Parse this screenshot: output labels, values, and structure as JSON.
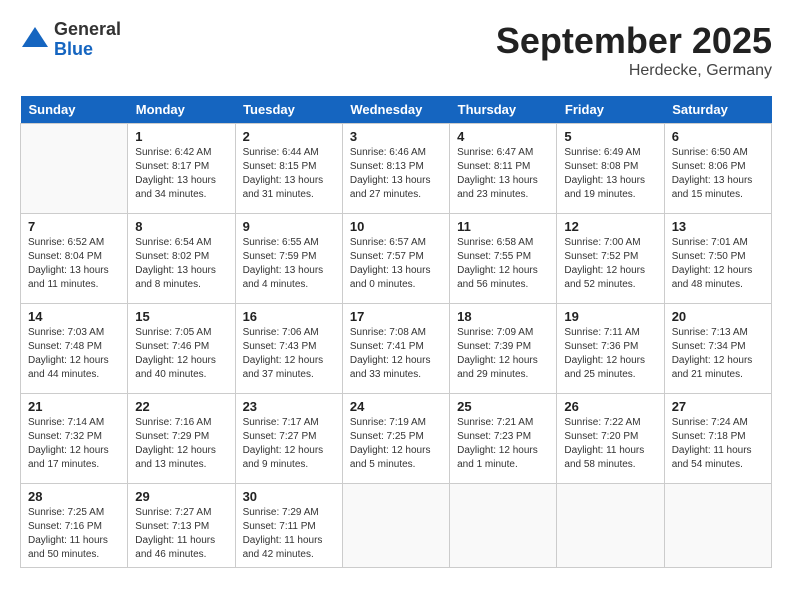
{
  "header": {
    "logo_general": "General",
    "logo_blue": "Blue",
    "month_title": "September 2025",
    "location": "Herdecke, Germany"
  },
  "days_of_week": [
    "Sunday",
    "Monday",
    "Tuesday",
    "Wednesday",
    "Thursday",
    "Friday",
    "Saturday"
  ],
  "weeks": [
    [
      {
        "day": "",
        "info": ""
      },
      {
        "day": "1",
        "info": "Sunrise: 6:42 AM\nSunset: 8:17 PM\nDaylight: 13 hours and 34 minutes."
      },
      {
        "day": "2",
        "info": "Sunrise: 6:44 AM\nSunset: 8:15 PM\nDaylight: 13 hours and 31 minutes."
      },
      {
        "day": "3",
        "info": "Sunrise: 6:46 AM\nSunset: 8:13 PM\nDaylight: 13 hours and 27 minutes."
      },
      {
        "day": "4",
        "info": "Sunrise: 6:47 AM\nSunset: 8:11 PM\nDaylight: 13 hours and 23 minutes."
      },
      {
        "day": "5",
        "info": "Sunrise: 6:49 AM\nSunset: 8:08 PM\nDaylight: 13 hours and 19 minutes."
      },
      {
        "day": "6",
        "info": "Sunrise: 6:50 AM\nSunset: 8:06 PM\nDaylight: 13 hours and 15 minutes."
      }
    ],
    [
      {
        "day": "7",
        "info": "Sunrise: 6:52 AM\nSunset: 8:04 PM\nDaylight: 13 hours and 11 minutes."
      },
      {
        "day": "8",
        "info": "Sunrise: 6:54 AM\nSunset: 8:02 PM\nDaylight: 13 hours and 8 minutes."
      },
      {
        "day": "9",
        "info": "Sunrise: 6:55 AM\nSunset: 7:59 PM\nDaylight: 13 hours and 4 minutes."
      },
      {
        "day": "10",
        "info": "Sunrise: 6:57 AM\nSunset: 7:57 PM\nDaylight: 13 hours and 0 minutes."
      },
      {
        "day": "11",
        "info": "Sunrise: 6:58 AM\nSunset: 7:55 PM\nDaylight: 12 hours and 56 minutes."
      },
      {
        "day": "12",
        "info": "Sunrise: 7:00 AM\nSunset: 7:52 PM\nDaylight: 12 hours and 52 minutes."
      },
      {
        "day": "13",
        "info": "Sunrise: 7:01 AM\nSunset: 7:50 PM\nDaylight: 12 hours and 48 minutes."
      }
    ],
    [
      {
        "day": "14",
        "info": "Sunrise: 7:03 AM\nSunset: 7:48 PM\nDaylight: 12 hours and 44 minutes."
      },
      {
        "day": "15",
        "info": "Sunrise: 7:05 AM\nSunset: 7:46 PM\nDaylight: 12 hours and 40 minutes."
      },
      {
        "day": "16",
        "info": "Sunrise: 7:06 AM\nSunset: 7:43 PM\nDaylight: 12 hours and 37 minutes."
      },
      {
        "day": "17",
        "info": "Sunrise: 7:08 AM\nSunset: 7:41 PM\nDaylight: 12 hours and 33 minutes."
      },
      {
        "day": "18",
        "info": "Sunrise: 7:09 AM\nSunset: 7:39 PM\nDaylight: 12 hours and 29 minutes."
      },
      {
        "day": "19",
        "info": "Sunrise: 7:11 AM\nSunset: 7:36 PM\nDaylight: 12 hours and 25 minutes."
      },
      {
        "day": "20",
        "info": "Sunrise: 7:13 AM\nSunset: 7:34 PM\nDaylight: 12 hours and 21 minutes."
      }
    ],
    [
      {
        "day": "21",
        "info": "Sunrise: 7:14 AM\nSunset: 7:32 PM\nDaylight: 12 hours and 17 minutes."
      },
      {
        "day": "22",
        "info": "Sunrise: 7:16 AM\nSunset: 7:29 PM\nDaylight: 12 hours and 13 minutes."
      },
      {
        "day": "23",
        "info": "Sunrise: 7:17 AM\nSunset: 7:27 PM\nDaylight: 12 hours and 9 minutes."
      },
      {
        "day": "24",
        "info": "Sunrise: 7:19 AM\nSunset: 7:25 PM\nDaylight: 12 hours and 5 minutes."
      },
      {
        "day": "25",
        "info": "Sunrise: 7:21 AM\nSunset: 7:23 PM\nDaylight: 12 hours and 1 minute."
      },
      {
        "day": "26",
        "info": "Sunrise: 7:22 AM\nSunset: 7:20 PM\nDaylight: 11 hours and 58 minutes."
      },
      {
        "day": "27",
        "info": "Sunrise: 7:24 AM\nSunset: 7:18 PM\nDaylight: 11 hours and 54 minutes."
      }
    ],
    [
      {
        "day": "28",
        "info": "Sunrise: 7:25 AM\nSunset: 7:16 PM\nDaylight: 11 hours and 50 minutes."
      },
      {
        "day": "29",
        "info": "Sunrise: 7:27 AM\nSunset: 7:13 PM\nDaylight: 11 hours and 46 minutes."
      },
      {
        "day": "30",
        "info": "Sunrise: 7:29 AM\nSunset: 7:11 PM\nDaylight: 11 hours and 42 minutes."
      },
      {
        "day": "",
        "info": ""
      },
      {
        "day": "",
        "info": ""
      },
      {
        "day": "",
        "info": ""
      },
      {
        "day": "",
        "info": ""
      }
    ]
  ]
}
